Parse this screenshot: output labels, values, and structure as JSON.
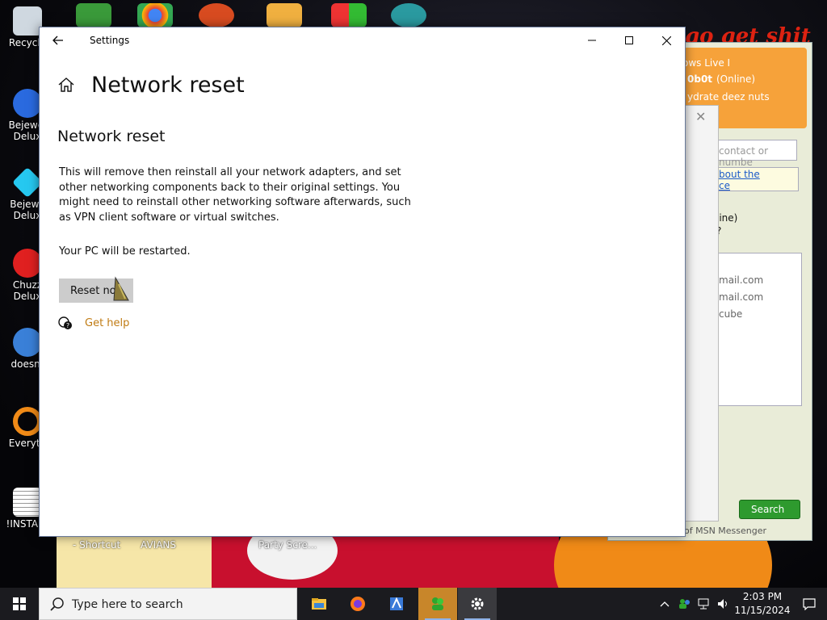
{
  "window": {
    "title": "Settings",
    "page_title": "Network reset",
    "section_title": "Network reset",
    "description": "This will remove then reinstall all your network adapters, and set other networking components back to their original settings. You might need to reinstall other networking software afterwards, such as VPN client software or virtual switches.",
    "restart_note": "Your PC will be restarted.",
    "reset_button": "Reset no",
    "help_link": "Get help"
  },
  "desktop_icons": [
    {
      "label": "Recycle",
      "icon": "recycle-bin-icon"
    },
    {
      "label": "Bejewel",
      "label2": "Delux",
      "icon": "bejeweled-icon"
    },
    {
      "label": "Bejewe",
      "label2": "Delux",
      "icon": "bejeweled-diamond-icon"
    },
    {
      "label": "Chuzz",
      "label2": "Delux",
      "icon": "chuzzle-icon"
    },
    {
      "label": "doesnt",
      "icon": "msn-bird-icon"
    },
    {
      "label": "Everyth",
      "icon": "everything-search-icon"
    },
    {
      "label": "!INSTALL",
      "icon": "installer-icon"
    }
  ],
  "wallpaper_labels": {
    "shortcut": "- Shortcut",
    "avians": "AVIANS",
    "party": "Party Scre...",
    "top_right": "go get shit"
  },
  "msn": {
    "title": "ows Live I",
    "status_name": "0b0t",
    "status": "(Online)",
    "message": "ydrate deez nuts",
    "search_placeholder": "contact or numbe",
    "link1": "bout the",
    "link2": "ce",
    "online_line1": "line)",
    "online_line2": "?",
    "contacts": [
      "mail.com",
      "mail.com",
      "cube"
    ],
    "search_button": "Search",
    "footer": "of MSN Messenger"
  },
  "taskbar": {
    "search_placeholder": "Type here to search",
    "time": "2:03 PM",
    "date": "11/15/2024",
    "apps": [
      "file-explorer-icon",
      "firefox-icon",
      "pinball-icon",
      "msn-messenger-icon",
      "settings-gear-icon"
    ]
  },
  "colors": {
    "accent_link": "#c07b13",
    "taskbar_bg": "#1b1b1f",
    "button_gray": "#cccccc"
  }
}
